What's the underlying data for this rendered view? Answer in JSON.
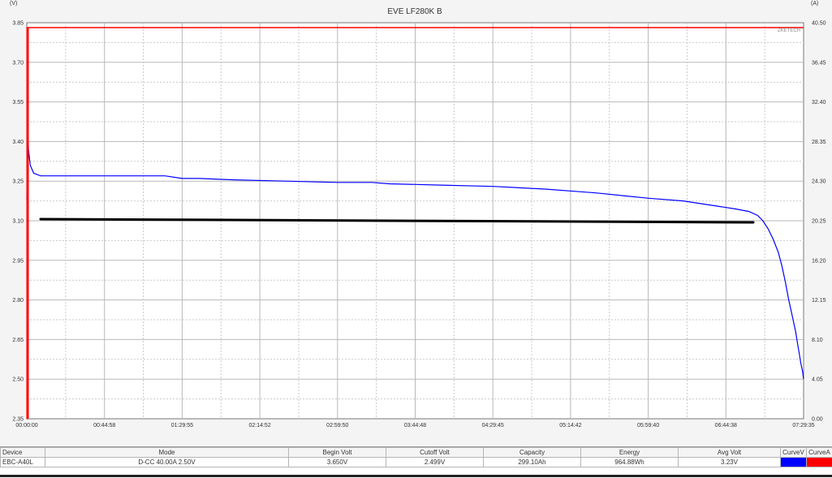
{
  "chart_data": {
    "type": "line",
    "title": "EVE LF280K B",
    "brand": "ZKETECH",
    "left_axis_unit": "(V)",
    "right_axis_unit": "(A)",
    "y_left": {
      "min": 2.35,
      "max": 3.85,
      "ticks": [
        "3.85",
        "3.70",
        "3.55",
        "3.40",
        "3.25",
        "3.10",
        "2.95",
        "2.80",
        "2.65",
        "2.50",
        "2.35"
      ]
    },
    "y_right": {
      "min": 0,
      "max": 40.5,
      "ticks": [
        "40.50",
        "36.45",
        "32.40",
        "28.35",
        "24.30",
        "20.25",
        "16.20",
        "12.15",
        "8.10",
        "4.05",
        "0.00"
      ]
    },
    "x_ticks": [
      "00:00:00",
      "00:44:58",
      "01:29:55",
      "02:14:52",
      "02:59:50",
      "03:44:48",
      "04:29:45",
      "05:14:42",
      "05:59:40",
      "06:44:38",
      "07:29:35"
    ],
    "grid": true,
    "series": [
      {
        "curve": "voltage",
        "color": "#0000ff",
        "x": [
          0,
          0.3,
          0.5,
          1,
          2,
          4,
          8,
          30,
          60,
          80,
          90,
          100,
          120,
          150,
          180,
          200,
          210,
          240,
          270,
          300,
          320,
          330,
          345,
          360,
          380,
          390,
          400,
          410,
          418,
          423,
          426,
          429,
          432,
          435,
          437,
          439,
          441,
          443,
          444,
          445,
          446,
          447,
          448,
          449,
          449.6
        ],
        "y": [
          3.18,
          3.44,
          3.52,
          3.37,
          3.31,
          3.28,
          3.27,
          3.27,
          3.27,
          3.27,
          3.26,
          3.26,
          3.255,
          3.25,
          3.245,
          3.245,
          3.24,
          3.235,
          3.23,
          3.22,
          3.21,
          3.205,
          3.195,
          3.185,
          3.175,
          3.165,
          3.155,
          3.145,
          3.135,
          3.12,
          3.1,
          3.07,
          3.03,
          2.98,
          2.93,
          2.87,
          2.8,
          2.74,
          2.71,
          2.68,
          2.64,
          2.6,
          2.56,
          2.53,
          2.5
        ]
      },
      {
        "curve": "current",
        "color": "#ff0000",
        "x": [
          0,
          0.1,
          0.15,
          449.6
        ],
        "y": [
          0,
          0,
          40.0,
          40.0
        ]
      }
    ]
  },
  "table": {
    "headers": [
      "Device",
      "Mode",
      "Begin Volt",
      "Cutoff Volt",
      "Capacity",
      "Energy",
      "Avg Volt",
      "CurveV",
      "CurveA"
    ],
    "row": [
      "EBC-A40L",
      "D-CC  40.00A  2.50V",
      "3.650V",
      "2.499V",
      "299.10Ah",
      "964.88Wh",
      "3.23V",
      "",
      ""
    ],
    "curve_colors": {
      "voltage": "#0000ff",
      "current": "#ff0000"
    }
  }
}
